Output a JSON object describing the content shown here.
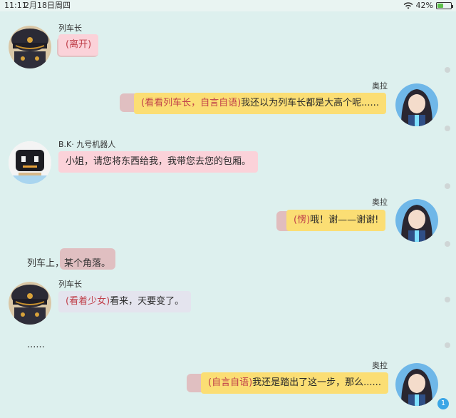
{
  "status_bar": {
    "time": "11:11",
    "date": "2月18日周四",
    "battery": "42%",
    "battery_level": 0.42
  },
  "messages": [
    {
      "speaker": "列车长",
      "text": "(离开)"
    },
    {
      "speaker": "奥拉",
      "paren": "(看看列车长，自言自语)",
      "text": "我还以为列车长都是大高个呢......"
    },
    {
      "speaker": "B.K· 九号机器人",
      "text": "小姐，请您将东西给我，我带您去您的包厢。"
    },
    {
      "speaker": "奥拉",
      "paren": "(愣)",
      "text": "哦！谢——谢谢!"
    },
    {
      "narration": "列车上，某个角落。"
    },
    {
      "speaker": "列车长",
      "paren": "(看着少女)",
      "text": "看来，天要变了。"
    },
    {
      "narration": "......"
    },
    {
      "speaker": "奥拉",
      "paren": "(自言自语)",
      "text": "我还是踏出了这一步，那么......"
    }
  ],
  "fab_label": "1",
  "colors": {
    "background": "#ddf0ee",
    "bubble_pink": "#fbd2d9",
    "bubble_yellow": "#fbde74",
    "bubble_grey": "#e4e4ee",
    "highlight_red": "#e8505a",
    "accent_blue": "#3ba6e6"
  }
}
